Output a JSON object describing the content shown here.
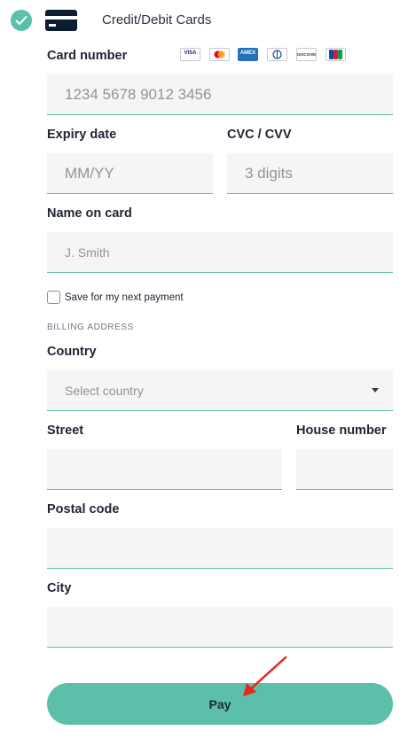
{
  "header": {
    "method_title": "Credit/Debit Cards"
  },
  "card_number": {
    "label": "Card number",
    "placeholder": "1234 5678 9012 3456",
    "brands": [
      "VISA",
      "Mastercard",
      "AMEX",
      "Diners",
      "Discover",
      "JCB"
    ]
  },
  "expiry": {
    "label": "Expiry date",
    "placeholder": "MM/YY"
  },
  "cvc": {
    "label": "CVC / CVV",
    "placeholder": "3 digits"
  },
  "name_on_card": {
    "label": "Name on card",
    "placeholder": "J. Smith"
  },
  "save_option": {
    "label": "Save for my next payment",
    "checked": false
  },
  "billing": {
    "section_title": "BILLING ADDRESS",
    "country": {
      "label": "Country",
      "placeholder": "Select country"
    },
    "street": {
      "label": "Street"
    },
    "house_number": {
      "label": "House number"
    },
    "postal_code": {
      "label": "Postal code"
    },
    "city": {
      "label": "City"
    }
  },
  "pay_button": {
    "label": "Pay"
  },
  "colors": {
    "accent": "#5bbfa9",
    "field_bg": "#f5f5f5",
    "card_icon": "#0d1b33",
    "annotation_arrow": "#e8261f"
  }
}
